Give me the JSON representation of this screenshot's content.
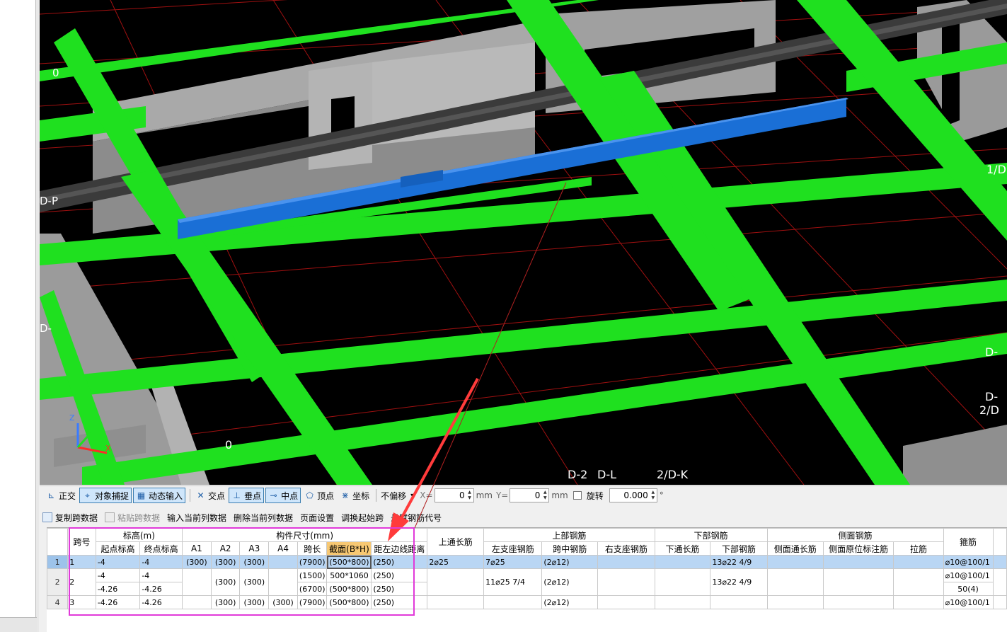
{
  "viewport": {
    "axis_labels": [
      "0",
      "1/D",
      "D-P",
      "D-",
      "D-",
      "D-",
      "2/D",
      "0",
      "D-2",
      "D-L",
      "2/D-K"
    ],
    "gizmo": {
      "z": "Z",
      "x": "X",
      "y": "Y"
    },
    "colors": {
      "beam_green": "#1fe01f",
      "beam_blue": "#1a6fd6",
      "wall_gray": "#a9a9a9",
      "grid_red": "#a01010",
      "background": "#000000"
    }
  },
  "snap_toolbar": {
    "ortho": "正交",
    "object_snap": "对象捕捉",
    "dynamic_input": "动态输入",
    "intersection": "交点",
    "perpendicular": "垂点",
    "midpoint": "中点",
    "vertex": "顶点",
    "coordinate": "坐标",
    "offset_select": "不偏移",
    "x_label": "X=",
    "x_value": "0",
    "y_label": "Y=",
    "y_value": "0",
    "unit": "mm",
    "rotate": "旋转",
    "rotate_value": "0.000",
    "degree": "°"
  },
  "action_toolbar": {
    "copy_span": "复制跨数据",
    "paste_span": "粘贴跨数据",
    "input_column": "输入当前列数据",
    "delete_column": "删除当前列数据",
    "page_setup": "页面设置",
    "swap_start": "调换起始跨",
    "cantilever_code": "悬臂钢筋代号"
  },
  "table": {
    "headers": {
      "span_no": "跨号",
      "elevation": "标高(m)",
      "start_elev": "起点标高",
      "end_elev": "终点标高",
      "dims": "构件尺寸(mm)",
      "a1": "A1",
      "a2": "A2",
      "a3": "A3",
      "a4": "A4",
      "span_len": "跨长",
      "section": "截面(B*H)",
      "dist_left": "距左边线距离",
      "top_through": "上通长筋",
      "top_rebar": "上部钢筋",
      "left_support": "左支座钢筋",
      "mid_span": "跨中钢筋",
      "right_support": "右支座钢筋",
      "bottom_rebar": "下部钢筋",
      "bottom_through": "下通长筋",
      "bottom_bars": "下部钢筋",
      "side_rebar": "侧面钢筋",
      "side_through": "侧面通长筋",
      "side_orig": "侧面原位标注筋",
      "tie": "拉筋",
      "stirrup": "箍筋"
    },
    "rows": [
      {
        "row_no": "1",
        "span": "1",
        "start": "-4",
        "end": "-4",
        "a1": "(300)",
        "a2": "(300)",
        "a3": "(300)",
        "a4": "",
        "len": "(7900)",
        "section": "(500*800)",
        "dist": "(250)",
        "top_through": "2⌀25",
        "left_support": "7⌀25",
        "mid_span": "(2⌀12)",
        "right_support": "",
        "bottom_through": "",
        "bottom_bars": "13⌀22 4/9",
        "side_through": "",
        "side_orig": "",
        "tie": "",
        "stirrup": "⌀10@100/1"
      },
      {
        "row_no": "2",
        "span": "2",
        "start_a": "-4",
        "end_a": "-4",
        "start_b": "-4.26",
        "end_b": "-4.26",
        "a1": "",
        "a2": "(300)",
        "a3": "(300)",
        "a4": "",
        "len_a": "(1500)",
        "section_a": "500*1060",
        "dist_a": "(250)",
        "len_b": "(6700)",
        "section_b": "(500*800)",
        "dist_b": "(250)",
        "left_support": "11⌀25 7/4",
        "mid_span": "(2⌀12)",
        "bottom_bars": "13⌀22 4/9",
        "stirrup_a": "⌀10@100/1",
        "stirrup_b": "50(4)"
      },
      {
        "row_no": "4",
        "span": "3",
        "start": "-4.26",
        "end": "-4.26",
        "a1": "",
        "a2": "(300)",
        "a3": "(300)",
        "a4": "(300)",
        "len": "(7900)",
        "section": "(500*800)",
        "dist": "(250)",
        "mid_span": "(2⌀12)",
        "stirrup": "⌀10@100/1"
      }
    ]
  }
}
